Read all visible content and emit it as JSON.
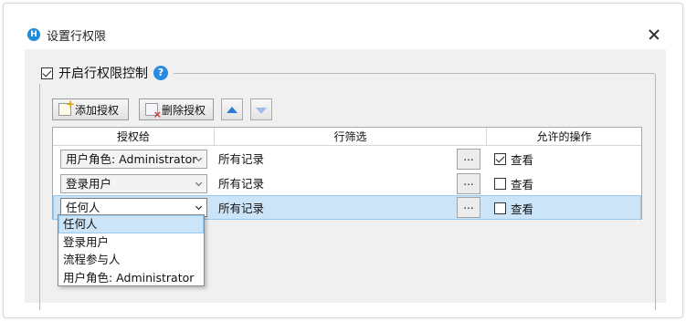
{
  "dialog": {
    "title": "设置行权限",
    "app_icon": "app-logo-icon",
    "close_icon": "close-icon"
  },
  "group": {
    "enable_label": "开启行权限控制",
    "enable_checked": true,
    "help_icon_glyph": "?"
  },
  "toolbar": {
    "add_label": "添加授权",
    "delete_label": "删除授权",
    "move_up_icon": "arrow-up-icon",
    "move_down_icon": "arrow-down-icon"
  },
  "grid": {
    "columns": [
      "授权给",
      "行筛选",
      "允许的操作"
    ],
    "rows": [
      {
        "grantee": "用户角色: Administrator",
        "filter": "所有记录",
        "filter_button": "...",
        "permission": "查看",
        "checked": true,
        "selected": false
      },
      {
        "grantee": "登录用户",
        "filter": "所有记录",
        "filter_button": "...",
        "permission": "查看",
        "checked": false,
        "selected": false
      },
      {
        "grantee": "任何人",
        "filter": "所有记录",
        "filter_button": "...",
        "permission": "查看",
        "checked": false,
        "selected": true
      }
    ]
  },
  "dropdown": {
    "options": [
      "任何人",
      "登录用户",
      "流程参与人",
      "用户角色: Administrator"
    ],
    "selected_index": 0
  },
  "colors": {
    "accent": "#2a8ce0",
    "selection": "#cce4f7",
    "selection_border": "#99c9ef",
    "panel_bg": "#f0f0f0"
  }
}
